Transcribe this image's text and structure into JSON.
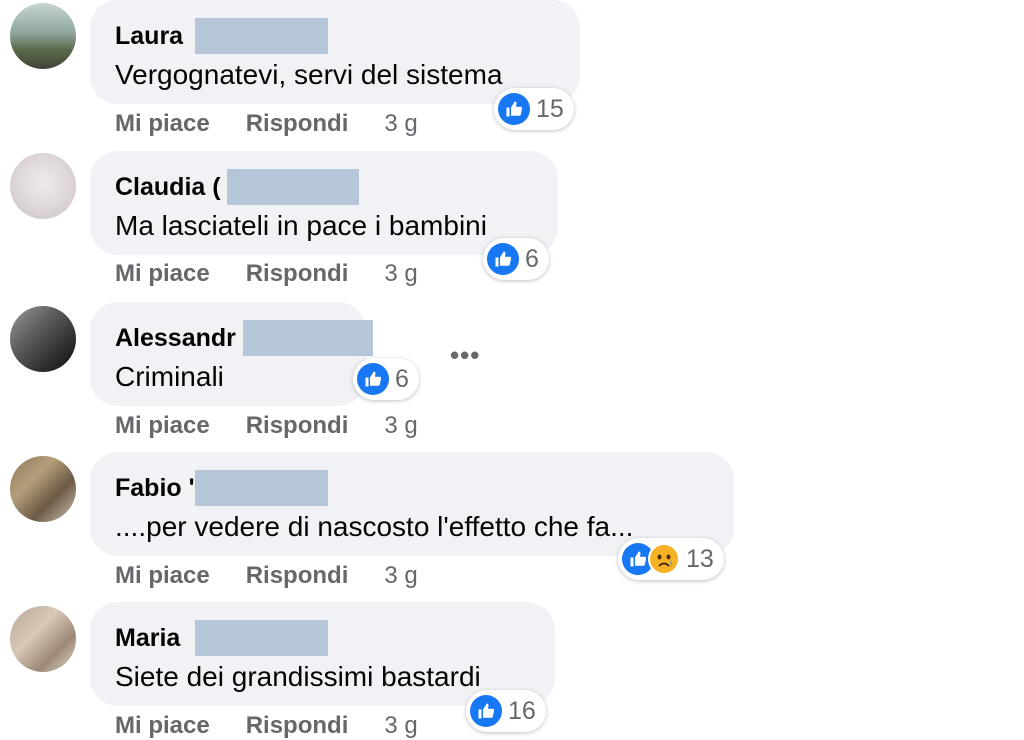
{
  "comments": [
    {
      "name": "Laura",
      "text": "Vergognatevi, servi del sistema",
      "reactions": "15",
      "like": "Mi piace",
      "reply": "Rispondi",
      "time": "3 g"
    },
    {
      "name": "Claudia (",
      "text": "Ma lasciateli in pace i bambini",
      "reactions": "6",
      "like": "Mi piace",
      "reply": "Rispondi",
      "time": "3 g"
    },
    {
      "name": "Alessandr",
      "text": "Criminali",
      "reactions": "6",
      "like": "Mi piace",
      "reply": "Rispondi",
      "time": "3 g"
    },
    {
      "name": "Fabio '",
      "text": "....per vedere di nascosto l'effetto che fa...",
      "reactions": "13",
      "like": "Mi piace",
      "reply": "Rispondi",
      "time": "3 g"
    },
    {
      "name": "Maria",
      "text": "Siete dei grandissimi bastardi",
      "reactions": "16",
      "like": "Mi piace",
      "reply": "Rispondi",
      "time": "3 g"
    }
  ],
  "more_options": "•••",
  "colors": {
    "like_blue": "#1877f2",
    "bubble_bg": "#f0f2f5",
    "meta_gray": "#65676b",
    "redaction": "#b6c6d9"
  },
  "icons": {
    "like": "thumbs-up-icon",
    "sad": "sad-face-icon",
    "more": "more-options-icon"
  }
}
